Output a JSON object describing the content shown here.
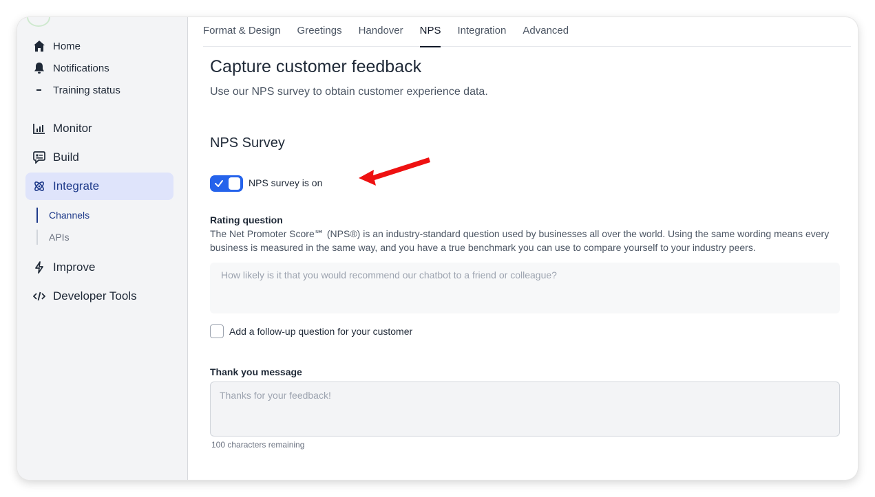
{
  "sidebar": {
    "small_items": [
      {
        "label": "Home",
        "icon": "home-icon"
      },
      {
        "label": "Notifications",
        "icon": "bell-icon"
      },
      {
        "label": "Training status",
        "icon": "dash-icon"
      }
    ],
    "big_items": [
      {
        "label": "Monitor",
        "icon": "chart-icon"
      },
      {
        "label": "Build",
        "icon": "chat-card-icon"
      },
      {
        "label": "Integrate",
        "icon": "atom-icon"
      },
      {
        "label": "Improve",
        "icon": "bolt-icon"
      },
      {
        "label": "Developer Tools",
        "icon": "code-icon"
      }
    ],
    "sub_items": [
      {
        "label": "Channels"
      },
      {
        "label": "APIs"
      }
    ],
    "active_item": "Integrate",
    "active_sub_item": "Channels"
  },
  "tabs": [
    "Format & Design",
    "Greetings",
    "Handover",
    "NPS",
    "Integration",
    "Advanced"
  ],
  "active_tab": "NPS",
  "main": {
    "title": "Capture customer feedback",
    "subtitle": "Use our NPS survey to obtain customer experience data.",
    "section_title": "NPS Survey",
    "toggle_label": "NPS survey is on",
    "toggle_on": true,
    "rating_label": "Rating question",
    "rating_help": "The Net Promoter Score℠ (NPS®) is an industry-standard question used by businesses all over the world. Using the same wording means every business is measured in the same way, and you have a true benchmark you can use to compare yourself to your industry peers.",
    "rating_placeholder": "How likely is it that you would recommend our chatbot to a friend or colleague?",
    "followup_label": "Add a follow-up question for your customer",
    "followup_checked": false,
    "thanks_label": "Thank you message",
    "thanks_placeholder": "Thanks for your feedback!",
    "chars_remaining": "100 characters remaining"
  },
  "colors": {
    "accent": "#2563eb",
    "active_nav_bg": "#dfe4fb",
    "active_nav_text": "#1e3a8a",
    "annotation_arrow": "#ee1111"
  }
}
